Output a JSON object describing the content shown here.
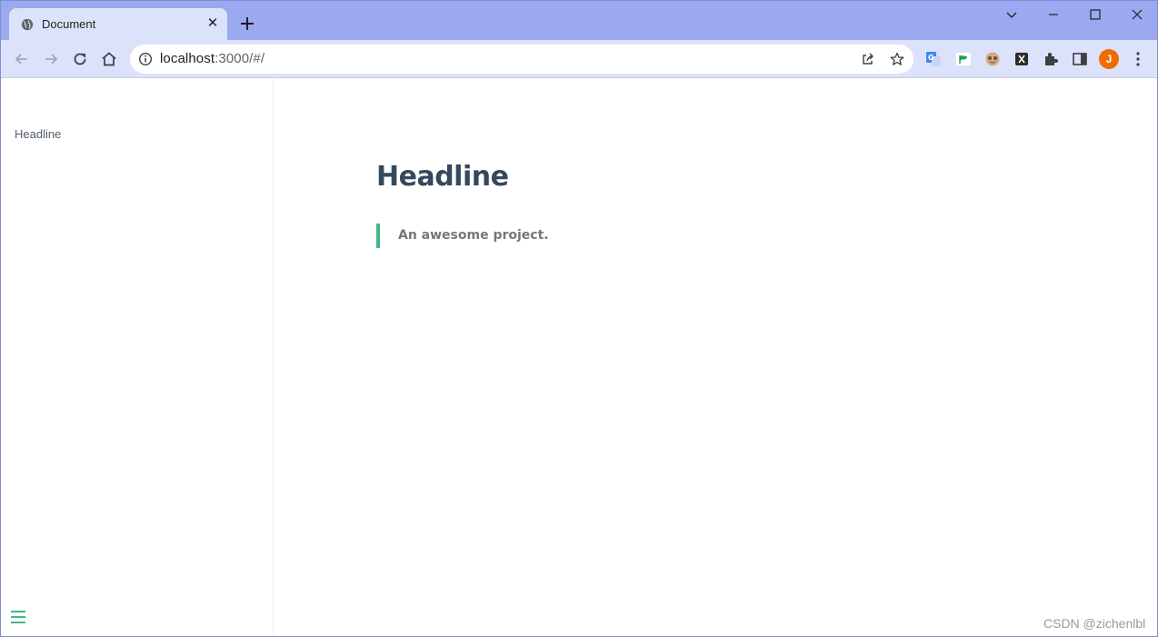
{
  "browser": {
    "tab": {
      "title": "Document",
      "favicon": "globe-icon",
      "close_glyph": "✕"
    },
    "toolbar": {
      "url_host": "localhost",
      "url_rest": ":3000/#/",
      "profile_initial": "J",
      "profile_color": "#ef6c00",
      "extensions": [
        "translate-extension-icon",
        "green-flag-extension-icon",
        "cat-extension-icon",
        "x-extension-icon",
        "puzzle-icon",
        "side-panel-icon"
      ]
    }
  },
  "page": {
    "sidebar": {
      "items": [
        {
          "label": "Headline"
        }
      ]
    },
    "content": {
      "headline": "Headline",
      "blockquote": "An awesome project."
    },
    "accent_color": "#42b983",
    "watermark": "CSDN @zichenlbl"
  }
}
